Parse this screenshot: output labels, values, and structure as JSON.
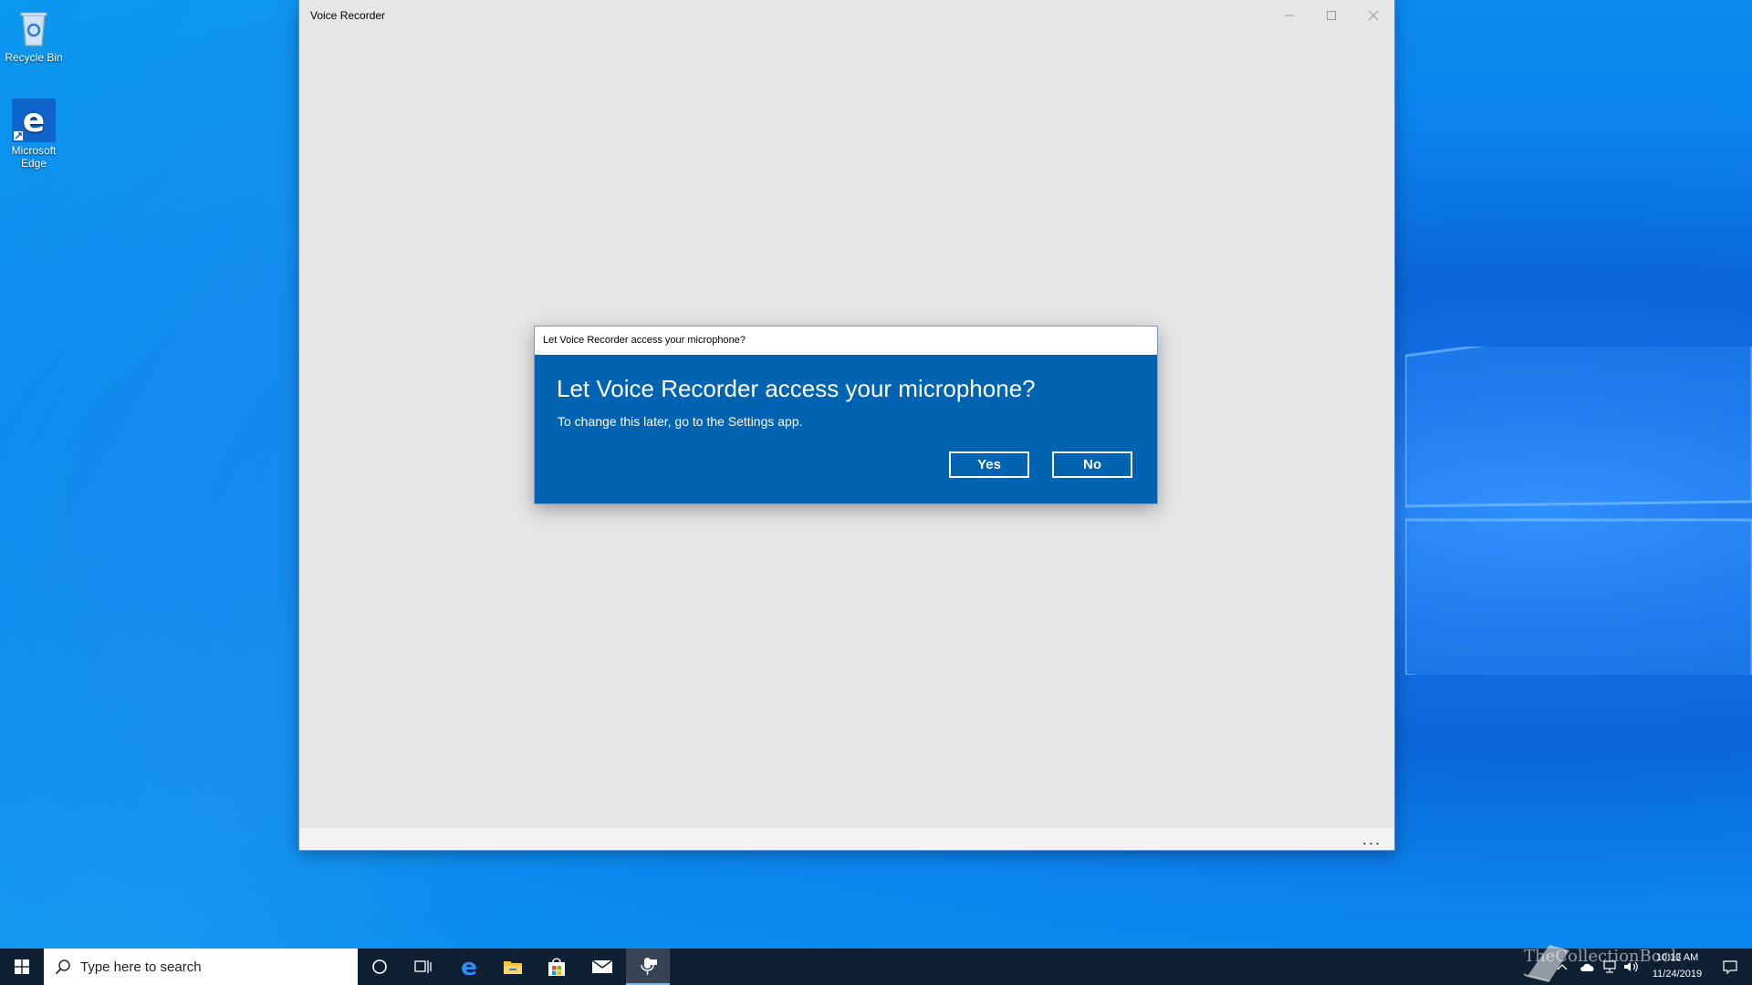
{
  "desktop": {
    "icons": [
      {
        "label": "Recycle Bin"
      },
      {
        "label": "Microsoft Edge"
      }
    ]
  },
  "app": {
    "title": "Voice Recorder",
    "footer_more": "..."
  },
  "dialog": {
    "window_title": "Let Voice Recorder access your microphone?",
    "heading": "Let Voice Recorder access your microphone?",
    "subtext": "To change this later, go to the Settings app.",
    "yes_label": "Yes",
    "no_label": "No",
    "bg_color": "#0063b1"
  },
  "taskbar": {
    "search_placeholder": "Type here to search",
    "time": "10:13 AM",
    "date": "11/24/2019",
    "bg_color": "#0f2035"
  },
  "watermark": "TheCollectionBook"
}
